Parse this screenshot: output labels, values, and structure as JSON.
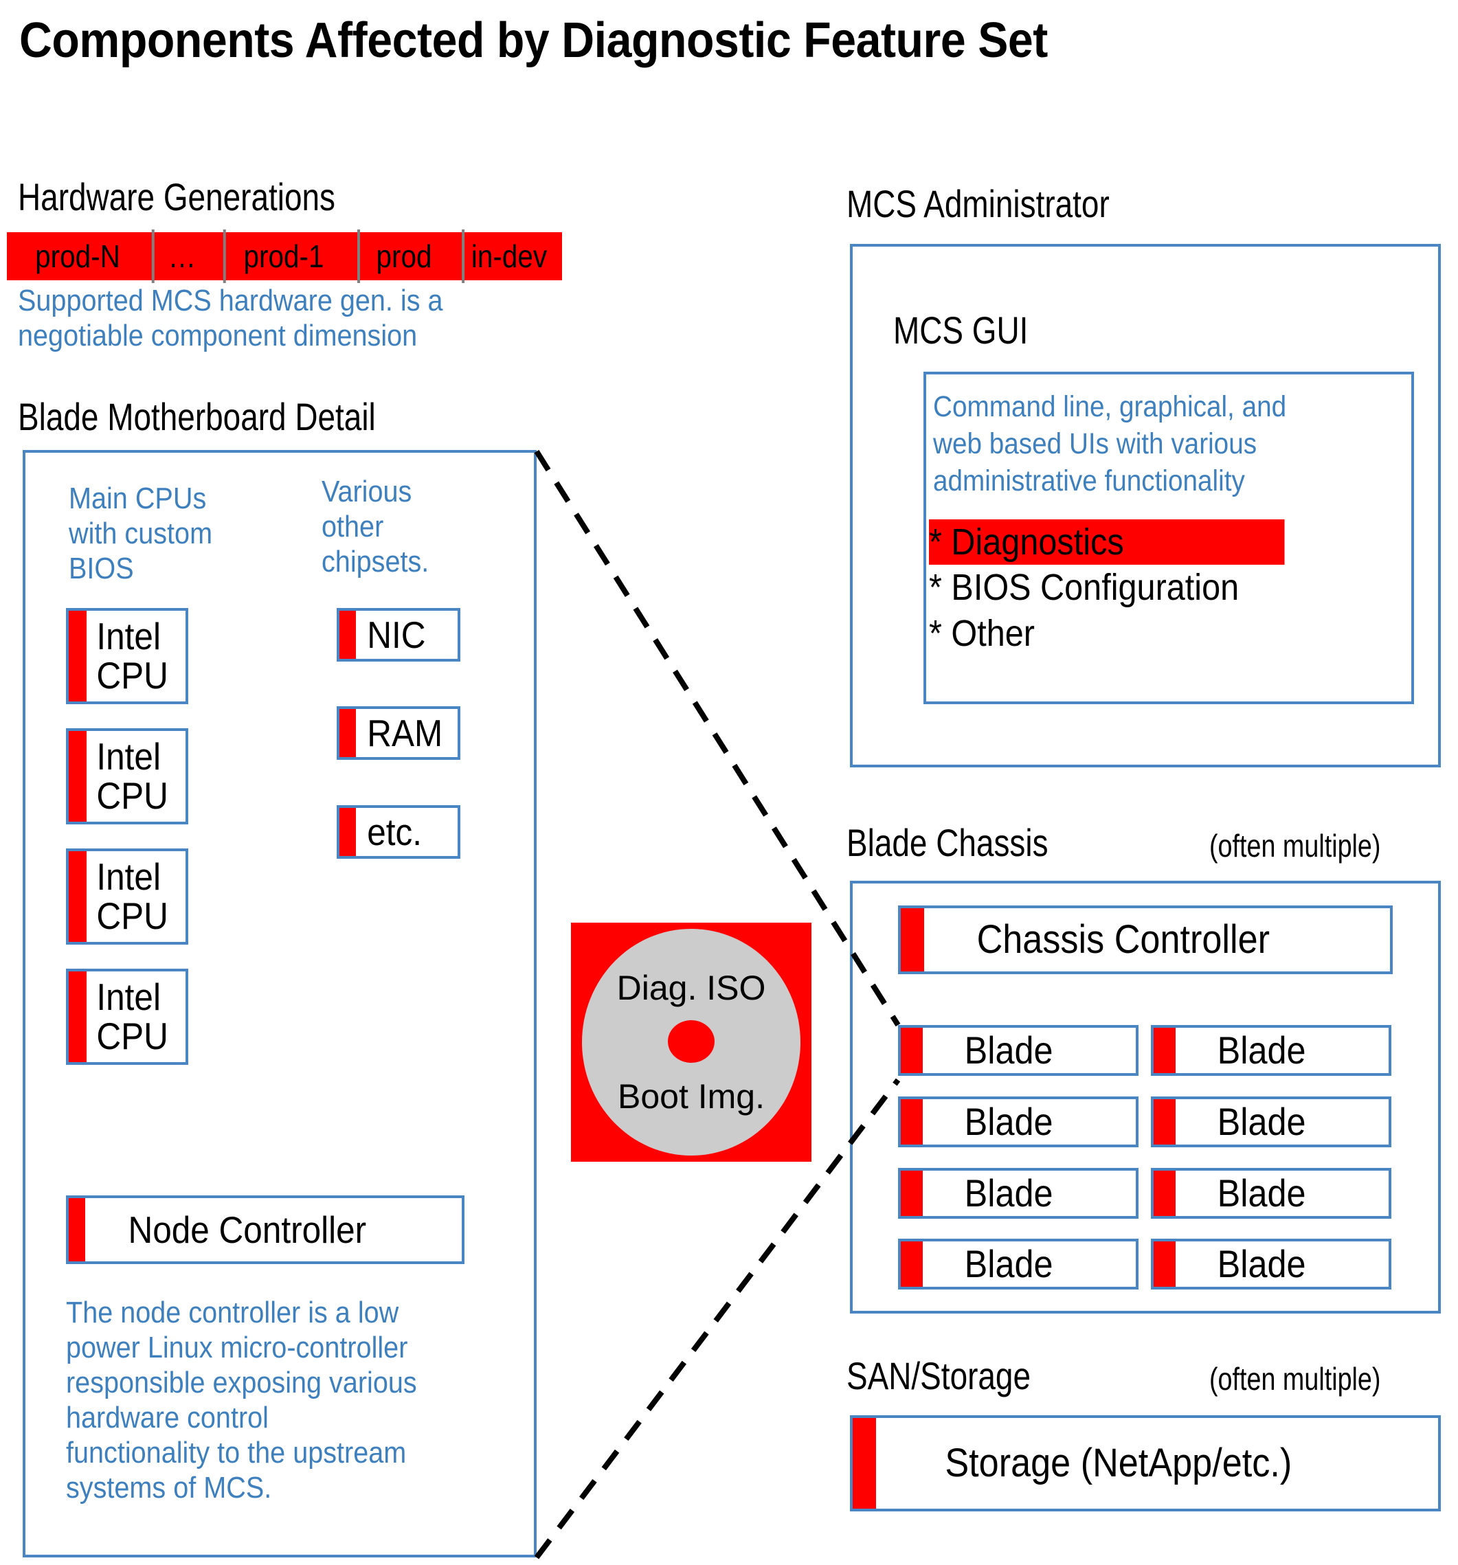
{
  "title": "Components Affected by Diagnostic Feature Set",
  "colors": {
    "highlight_red": "#FF0000",
    "box_blue": "#4A86C4",
    "note_blue": "#3E80BE",
    "disc_gray": "#CCCCCC",
    "divider_gray": "#808080"
  },
  "hardware_generations": {
    "label": "Hardware Generations",
    "generations": [
      "prod-N",
      "…",
      "prod-1",
      "prod",
      "in-dev"
    ],
    "note": "Supported MCS hardware gen. is a negotiable component dimension"
  },
  "blade_motherboard": {
    "label": "Blade Motherboard Detail",
    "cpu_note": "Main CPUs with custom BIOS",
    "chipset_note": "Various other chipsets.",
    "cpus": [
      "Intel\nCPU",
      "Intel\nCPU",
      "Intel\nCPU",
      "Intel\nCPU"
    ],
    "chipsets": [
      "NIC",
      "RAM",
      "etc."
    ],
    "node_controller": "Node Controller",
    "node_controller_note": "The node controller is a low power Linux  micro-controller responsible exposing various hardware control functionality to the upstream systems of MCS."
  },
  "diag_iso": {
    "line1": "Diag. ISO",
    "line2": "Boot Img."
  },
  "mcs_administrator": {
    "label": "MCS Administrator",
    "gui_label": "MCS GUI",
    "gui_note": "Command line, graphical, and web based UIs with various administrative functionality",
    "gui_items": [
      {
        "text": "* Diagnostics",
        "highlighted": true
      },
      {
        "text": "* BIOS Configuration",
        "highlighted": false
      },
      {
        "text": "* Other",
        "highlighted": false
      }
    ]
  },
  "blade_chassis": {
    "label": "Blade Chassis",
    "sublabel": "(often multiple)",
    "controller": "Chassis Controller",
    "blades_left": [
      "Blade",
      "Blade",
      "Blade",
      "Blade"
    ],
    "blades_right": [
      "Blade",
      "Blade",
      "Blade",
      "Blade"
    ]
  },
  "san_storage": {
    "label": "SAN/Storage",
    "sublabel": "(often multiple)",
    "storage": "Storage (NetApp/etc.)"
  }
}
